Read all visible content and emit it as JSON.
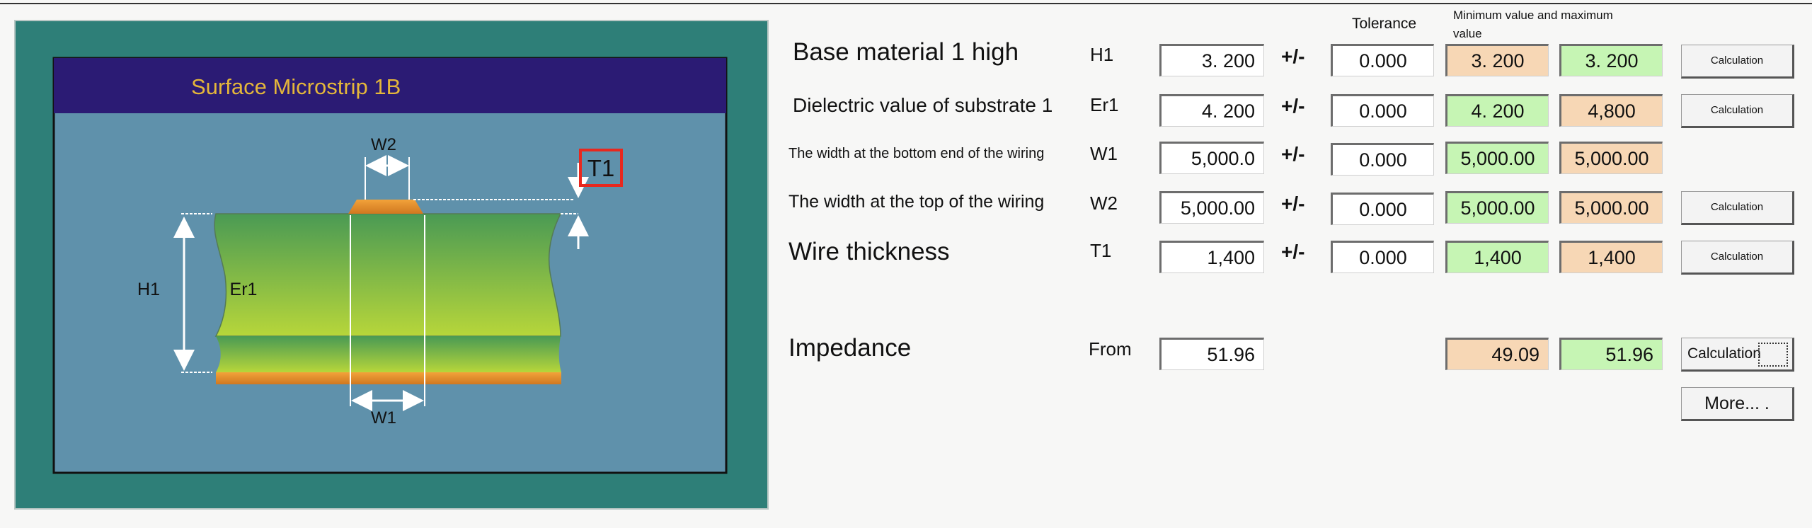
{
  "diagram": {
    "title": "Surface Microstrip 1B",
    "labels": {
      "w2": "W2",
      "w1": "W1",
      "h1": "H1",
      "er1": "Er1",
      "t1": "T1"
    }
  },
  "headers": {
    "tolerance": "Tolerance",
    "minmax_line1": "Minimum value and maximum",
    "minmax_line2": "value"
  },
  "rows": [
    {
      "label": "Base material 1 high",
      "symbol": "H1",
      "value": "3. 200",
      "pm": "+/-",
      "tolerance": "0.000",
      "min": "3. 200",
      "max": "3. 200",
      "button": "Calculation"
    },
    {
      "label": "Dielectric value of substrate 1",
      "symbol": "Er1",
      "value": "4. 200",
      "pm": "+/-",
      "tolerance": "0.000",
      "min": "4. 200",
      "max": "4,800",
      "button": "Calculation"
    },
    {
      "label": "The width at the bottom end of the wiring",
      "symbol": "W1",
      "value": "5,000.0",
      "pm": "+/-",
      "tolerance": "0.000",
      "min": "5,000.00",
      "max": "5,000.00"
    },
    {
      "label": "The width at the top of the wiring",
      "symbol": "W2",
      "value": "5,000.00",
      "pm": "+/-",
      "tolerance": "0.000",
      "min": "5,000.00",
      "max": "5,000.00",
      "button": "Calculation"
    },
    {
      "label": "Wire thickness",
      "symbol": "T1",
      "value": "1,400",
      "pm": "+/-",
      "tolerance": "0.000",
      "min": "1,400",
      "max": "1,400",
      "button": "Calculation"
    }
  ],
  "impedance": {
    "label": "Impedance",
    "from_label": "From",
    "value": "51.96",
    "min": "49.09",
    "max": "51.96",
    "button": "Calculation"
  },
  "more_button": "More... ."
}
